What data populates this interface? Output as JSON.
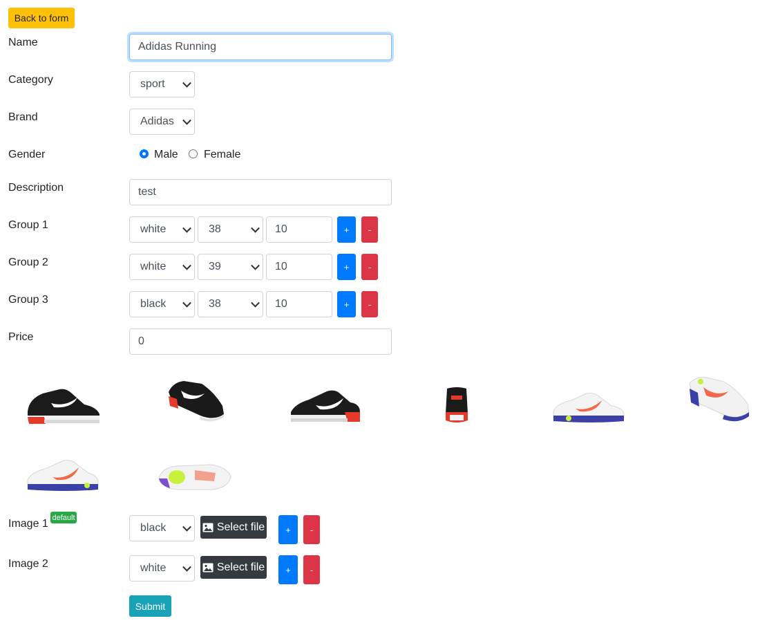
{
  "back_button": "Back to form",
  "labels": {
    "name": "Name",
    "category": "Category",
    "brand": "Brand",
    "gender": "Gender",
    "description": "Description",
    "price": "Price"
  },
  "fields": {
    "name": "Adidas Running",
    "category": "sport",
    "brand": "Adidas",
    "description": "test",
    "price": "0"
  },
  "gender": {
    "male": "Male",
    "female": "Female",
    "selected": "Male"
  },
  "groups": [
    {
      "label": "Group 1",
      "color": "white",
      "size": "38",
      "qty": "10"
    },
    {
      "label": "Group 2",
      "color": "white",
      "size": "39",
      "qty": "10"
    },
    {
      "label": "Group 3",
      "color": "black",
      "size": "38",
      "qty": "10"
    }
  ],
  "add_label": "+",
  "remove_label": "-",
  "images": [
    {
      "label": "Image 1",
      "color": "black",
      "badge": "default",
      "file_button": "Select file"
    },
    {
      "label": "Image 2",
      "color": "white",
      "file_button": "Select file"
    }
  ],
  "thumbnails": [
    {
      "name": "black-red-sneaker-side"
    },
    {
      "name": "black-red-sneaker-angle"
    },
    {
      "name": "black-red-sneaker-side-2"
    },
    {
      "name": "black-red-sneaker-back"
    },
    {
      "name": "white-blue-sneaker-side"
    },
    {
      "name": "white-blue-sneaker-angle"
    },
    {
      "name": "white-blue-sneaker-side-2"
    },
    {
      "name": "white-blue-sneaker-top"
    }
  ],
  "submit": "Submit",
  "colors": {
    "warning": "#ffc107",
    "primary": "#007bff",
    "danger": "#dc3545",
    "success": "#28a745",
    "info": "#17a2b8",
    "dark": "#343a40"
  }
}
